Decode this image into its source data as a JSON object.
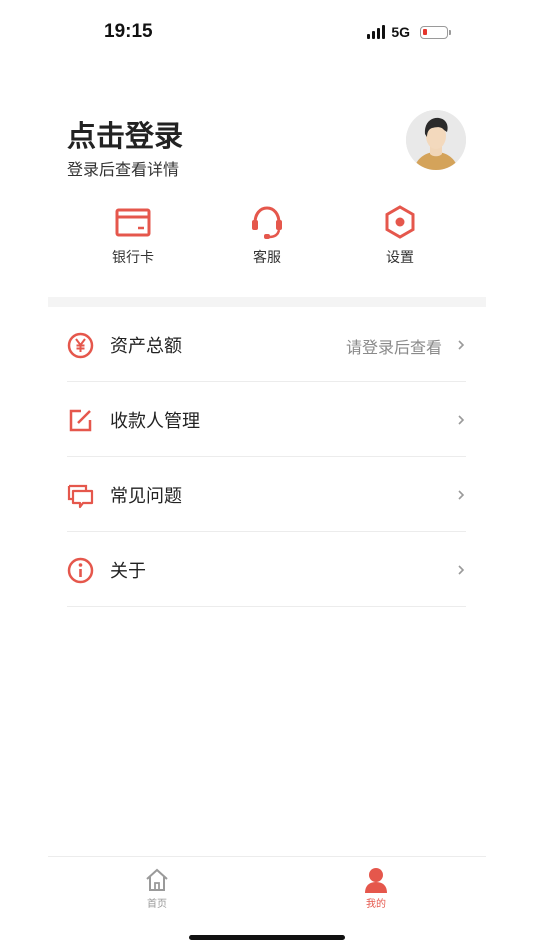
{
  "status_bar": {
    "time": "19:15",
    "network": "5G"
  },
  "profile": {
    "title": "点击登录",
    "subtitle": "登录后查看详情"
  },
  "quick_actions": [
    {
      "label": "银行卡",
      "icon": "bank-card-icon"
    },
    {
      "label": "客服",
      "icon": "headset-icon"
    },
    {
      "label": "设置",
      "icon": "settings-hexagon-icon"
    }
  ],
  "menu": [
    {
      "label": "资产总额",
      "value": "请登录后查看",
      "icon": "yen-circle-icon"
    },
    {
      "label": "收款人管理",
      "value": "",
      "icon": "edit-icon"
    },
    {
      "label": "常见问题",
      "value": "",
      "icon": "chat-bubbles-icon"
    },
    {
      "label": "关于",
      "value": "",
      "icon": "info-circle-icon"
    }
  ],
  "tabbar": [
    {
      "label": "首页",
      "icon": "home-icon",
      "active": false
    },
    {
      "label": "我的",
      "icon": "user-icon",
      "active": true
    }
  ],
  "colors": {
    "accent": "#e5574c",
    "inactive": "#9a9a9a",
    "text": "#222222"
  }
}
